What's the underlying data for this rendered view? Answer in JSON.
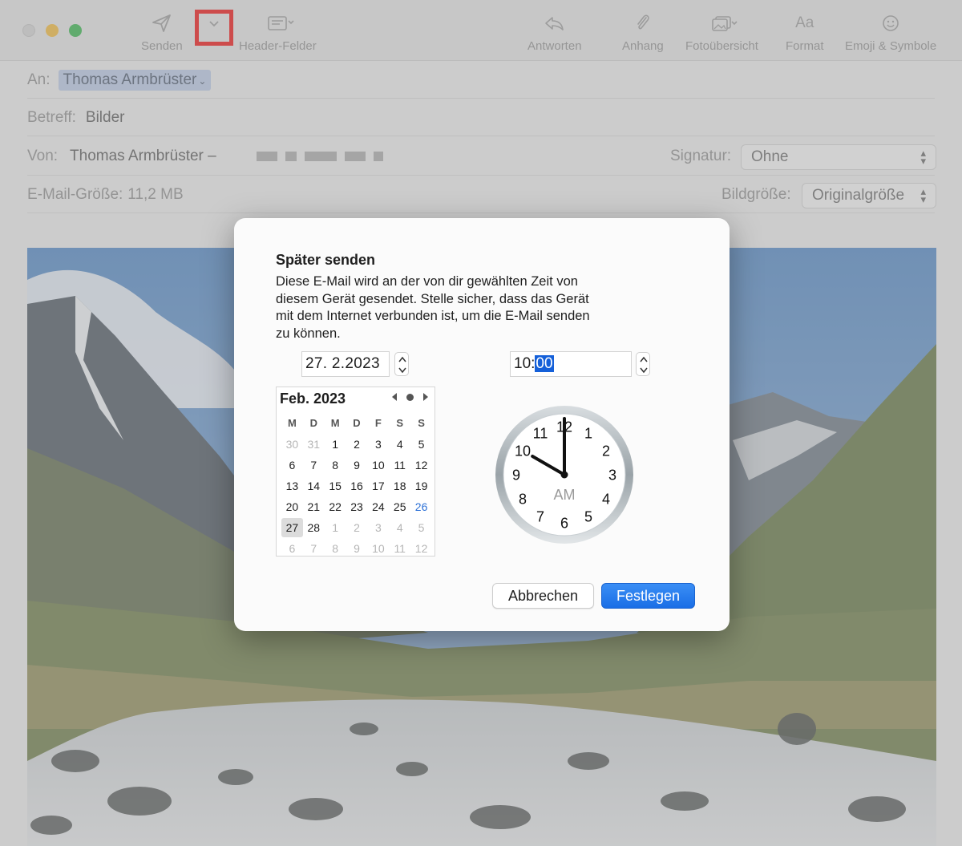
{
  "toolbar": {
    "send_label": "Senden",
    "header_fields_label": "Header-Felder",
    "reply_label": "Antworten",
    "attachment_label": "Anhang",
    "photo_browser_label": "Fotoübersicht",
    "format_label": "Format",
    "format_icon_text": "Aa",
    "emoji_label": "Emoji & Symbole"
  },
  "fields": {
    "to_label": "An:",
    "to_value": "Thomas Armbrüster",
    "subject_label": "Betreff:",
    "subject_value": "Bilder",
    "from_label": "Von:",
    "from_value": "Thomas Armbrüster –",
    "signature_label": "Signatur:",
    "signature_value": "Ohne",
    "size_label": "E-Mail-Größe:",
    "size_value": "11,2 MB",
    "image_size_label": "Bildgröße:",
    "image_size_value": "Originalgröße"
  },
  "dialog": {
    "title": "Später senden",
    "message_lines": [
      "Diese E-Mail wird an der von dir gewählten Zeit von",
      "diesem Gerät gesendet. Stelle sicher, dass das Gerät",
      "mit dem Internet verbunden ist, um die E-Mail senden",
      "zu können."
    ],
    "date_value": "27.  2.2023",
    "time_hour": "10:",
    "time_minute": "00",
    "clock_period": "AM",
    "clock_hour": 10,
    "clock_minute": 0,
    "cancel_label": "Abbrechen",
    "confirm_label": "Festlegen"
  },
  "calendar": {
    "month_label": "Feb. 2023",
    "weekdays": [
      "M",
      "D",
      "M",
      "D",
      "F",
      "S",
      "S"
    ],
    "weeks": [
      [
        {
          "d": "30",
          "m": true
        },
        {
          "d": "31",
          "m": true
        },
        {
          "d": "1"
        },
        {
          "d": "2"
        },
        {
          "d": "3"
        },
        {
          "d": "4"
        },
        {
          "d": "5"
        }
      ],
      [
        {
          "d": "6"
        },
        {
          "d": "7"
        },
        {
          "d": "8"
        },
        {
          "d": "9"
        },
        {
          "d": "10"
        },
        {
          "d": "11"
        },
        {
          "d": "12"
        }
      ],
      [
        {
          "d": "13"
        },
        {
          "d": "14"
        },
        {
          "d": "15"
        },
        {
          "d": "16"
        },
        {
          "d": "17"
        },
        {
          "d": "18"
        },
        {
          "d": "19"
        }
      ],
      [
        {
          "d": "20"
        },
        {
          "d": "21"
        },
        {
          "d": "22"
        },
        {
          "d": "23"
        },
        {
          "d": "24"
        },
        {
          "d": "25"
        },
        {
          "d": "26",
          "t": true
        }
      ],
      [
        {
          "d": "27",
          "s": true
        },
        {
          "d": "28"
        },
        {
          "d": "1",
          "m": true
        },
        {
          "d": "2",
          "m": true
        },
        {
          "d": "3",
          "m": true
        },
        {
          "d": "4",
          "m": true
        },
        {
          "d": "5",
          "m": true
        }
      ],
      [
        {
          "d": "6",
          "m": true
        },
        {
          "d": "7",
          "m": true
        },
        {
          "d": "8",
          "m": true
        },
        {
          "d": "9",
          "m": true
        },
        {
          "d": "10",
          "m": true
        },
        {
          "d": "11",
          "m": true
        },
        {
          "d": "12",
          "m": true
        }
      ]
    ]
  },
  "colors": {
    "accent": "#1560d9",
    "today": "#2a6fd6",
    "highlight_box": "#ee1111"
  }
}
